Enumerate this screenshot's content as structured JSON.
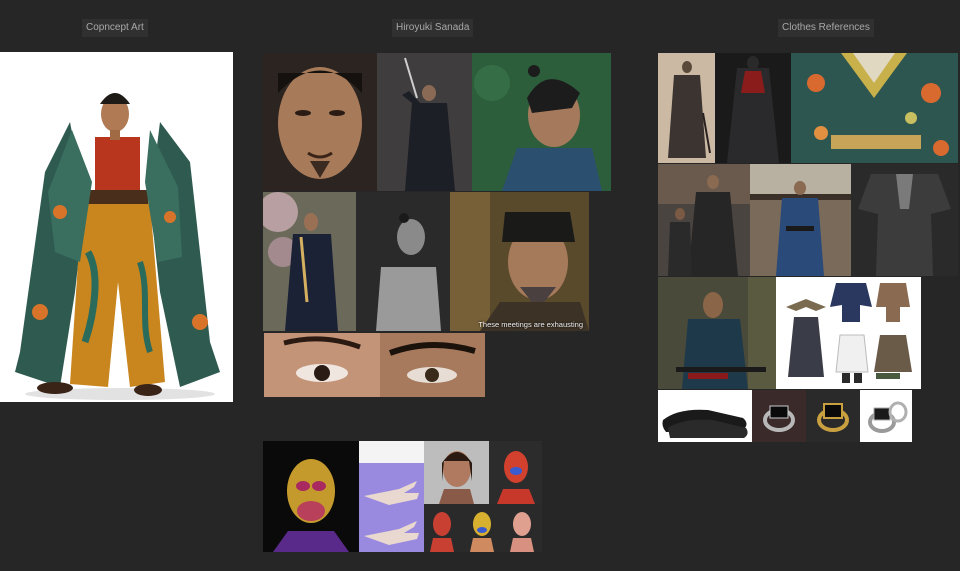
{
  "board": {
    "sections": {
      "concept": {
        "label": "Copncept Art"
      },
      "actor": {
        "label": "Hiroyuki Sanada"
      },
      "clothes": {
        "label": "Clothes References"
      }
    }
  },
  "images": {
    "concept_art": {
      "icon": "samurai-concept-illustration"
    },
    "actor_portrait_closeup": {
      "icon": "face-portrait"
    },
    "actor_sword_raised": {
      "icon": "sword-pose"
    },
    "actor_profile_green": {
      "icon": "profile-portrait"
    },
    "actor_katana_stance": {
      "icon": "katana-stance"
    },
    "actor_bw_shirtless": {
      "icon": "bw-photo"
    },
    "actor_meeting_still": {
      "icon": "movie-still",
      "subtitle": "These meetings are exhausting"
    },
    "eye_closeup_left": {
      "icon": "eye-detail"
    },
    "eye_closeup_right": {
      "icon": "eye-detail"
    },
    "texture_head": {
      "icon": "texture-map"
    },
    "texture_hands": {
      "icon": "hand-uv"
    },
    "texture_female_head": {
      "icon": "3d-head"
    },
    "texture_red_bust": {
      "icon": "3d-bust"
    },
    "texture_heads_row": {
      "icon": "3d-heads"
    },
    "clothes_old_photo": {
      "icon": "historic-photo"
    },
    "clothes_dark_hakama": {
      "icon": "hakama"
    },
    "clothes_floral_kimono": {
      "icon": "floral-fabric"
    },
    "clothes_walking_samurai": {
      "icon": "samurai-walk"
    },
    "clothes_blue_kimono": {
      "icon": "blue-kimono"
    },
    "clothes_grey_kimono": {
      "icon": "grey-kimono"
    },
    "clothes_forest_samurai": {
      "icon": "samurai-forest"
    },
    "clothes_outfit_diagram": {
      "icon": "outfit-breakdown"
    },
    "clothes_loafers": {
      "icon": "shoes"
    },
    "clothes_ring_black": {
      "icon": "ring"
    },
    "clothes_ring_gold": {
      "icon": "ring"
    },
    "clothes_ring_silver": {
      "icon": "ring"
    }
  },
  "colors": {
    "background": "#262626",
    "label_bg": "#303030",
    "label_text": "#a8a8a8"
  }
}
